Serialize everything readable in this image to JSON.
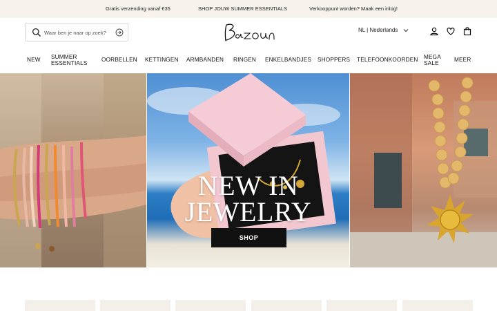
{
  "topbar": {
    "msg1": "Gratis verzending vanaf €35",
    "msg2": "SHOP JOUW SUMMER ESSENTIALS",
    "msg3": "Verkooppunt worden? Maak een inlog!"
  },
  "header": {
    "search_placeholder": "Waar ben je naar op zoek?",
    "language": "NL | Nederlands"
  },
  "nav": {
    "items": [
      "NEW",
      "SUMMER",
      "ESSENTIALS",
      "OORBELLEN",
      "KETTINGEN",
      "ARMBANDEN",
      "RINGEN",
      "ENKELBANDJES",
      "SHOPPERS",
      "TELEFOONKOORDEN",
      "MEGA",
      "SALE",
      "MEER"
    ]
  },
  "hero": {
    "title_line1": "NEW IN",
    "title_line2": "JEWELRY",
    "button": "SHOP"
  },
  "colors": {
    "topbar_bg": "#f7f3ec",
    "button_bg": "#111111",
    "card_bg": "#f4efe8"
  },
  "icons": [
    "search-icon",
    "arrow-circle-icon",
    "chevron-down-icon",
    "user-icon",
    "heart-icon",
    "bag-icon"
  ]
}
